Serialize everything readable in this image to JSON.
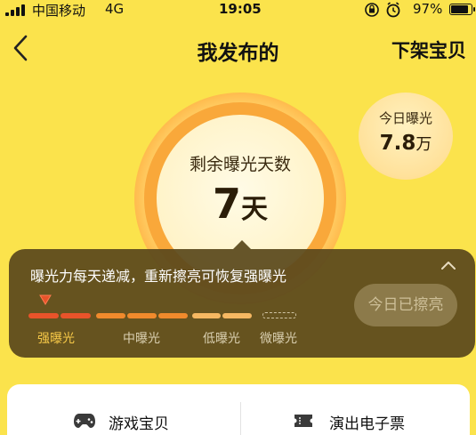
{
  "status_bar": {
    "carrier": "中国移动",
    "network": "4G",
    "time": "19:05",
    "battery": "97%"
  },
  "nav": {
    "title": "我发布的",
    "right_action": "下架宝贝"
  },
  "exposure": {
    "days_label": "剩余曝光天数",
    "days_number": "7",
    "days_unit": "天"
  },
  "today": {
    "label": "今日曝光",
    "number": "7.8",
    "unit": "万"
  },
  "info_panel": {
    "message": "曝光力每天递减，重新擦亮可恢复强曝光",
    "polish_button": "今日已擦亮",
    "levels": [
      {
        "label": "强曝光",
        "color": "#e8532a",
        "active": true
      },
      {
        "label": "中曝光",
        "color": "#f08a2c",
        "active": false
      },
      {
        "label": "低曝光",
        "color": "#f6b862",
        "active": false
      },
      {
        "label": "微曝光",
        "color": "#cfc3a2",
        "active": false
      }
    ],
    "current_level_label_color": "#f7c948"
  },
  "bottom_tabs": [
    {
      "label": "游戏宝贝",
      "icon": "gamepad-icon"
    },
    {
      "label": "演出电子票",
      "icon": "ticket-icon"
    }
  ],
  "colors": {
    "background": "#fbe34c",
    "ring": "#f9a83a",
    "panel": "#5a481c"
  }
}
